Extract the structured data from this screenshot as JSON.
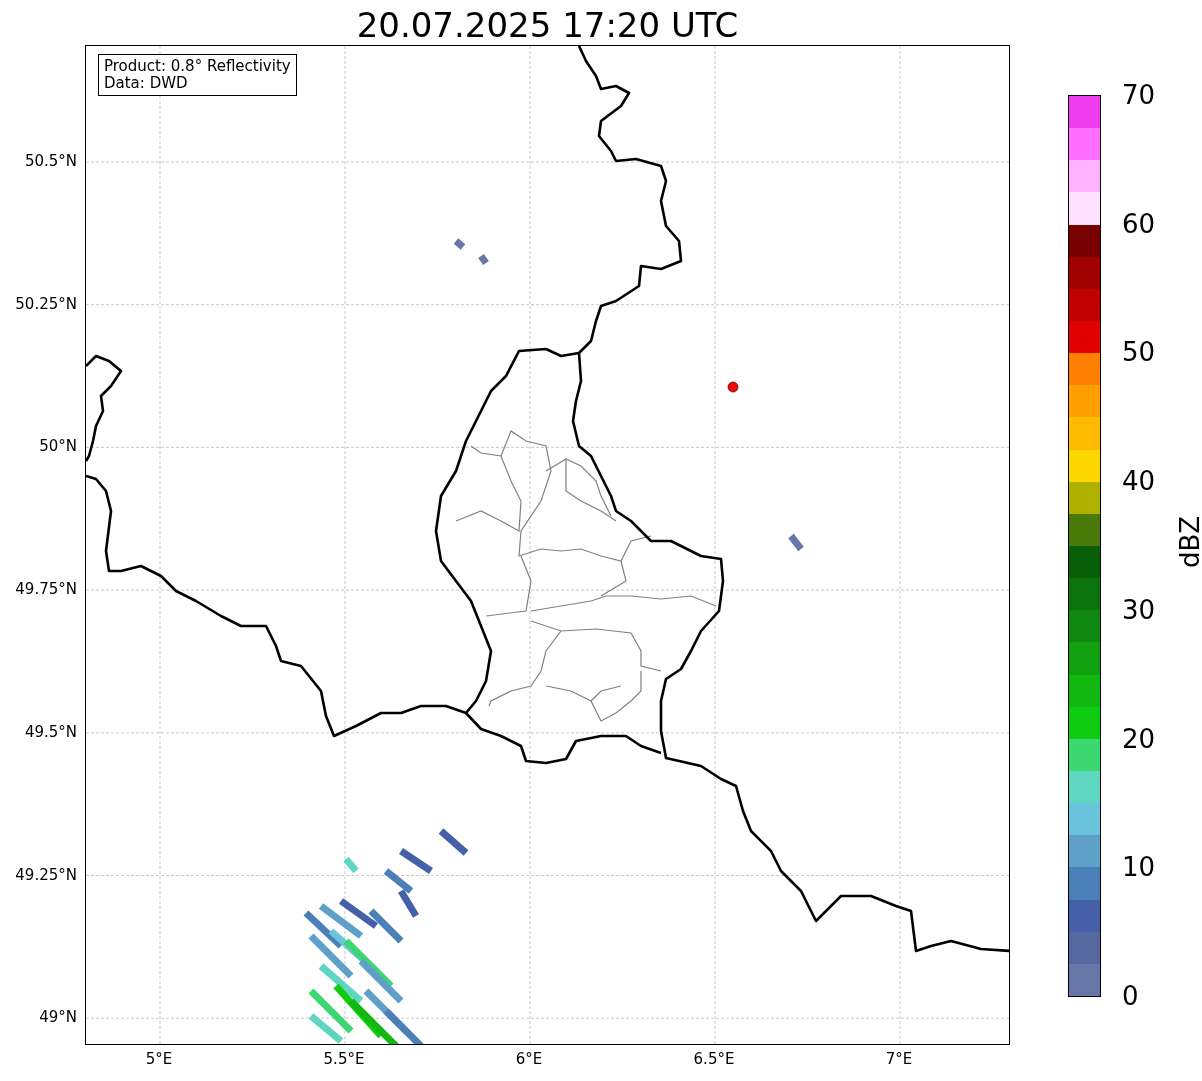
{
  "title": "20.07.2025 17:20 UTC",
  "info_box": {
    "lines": [
      "Product: 0.8° Reflectivity",
      "Data: DWD"
    ]
  },
  "map": {
    "lat_ticks": [
      "50.5°N",
      "50.25°N",
      "50°N",
      "49.75°N",
      "49.5°N",
      "49.25°N",
      "49°N"
    ],
    "lon_ticks": [
      "5°E",
      "5.5°E",
      "6°E",
      "6.5°E",
      "7°E"
    ]
  },
  "colorbar": {
    "label": "dBZ",
    "ticks": [
      "70",
      "60",
      "50",
      "40",
      "30",
      "20",
      "10",
      "0"
    ],
    "bins": [
      {
        "color": "#ee3cee"
      },
      {
        "color": "#ff6eff"
      },
      {
        "color": "#ffb3ff"
      },
      {
        "color": "#ffe0ff"
      },
      {
        "color": "#780000"
      },
      {
        "color": "#a00000"
      },
      {
        "color": "#c00000"
      },
      {
        "color": "#e00000"
      },
      {
        "color": "#ff7f00"
      },
      {
        "color": "#ff9f00"
      },
      {
        "color": "#ffbb00"
      },
      {
        "color": "#ffd700"
      },
      {
        "color": "#b0b000"
      },
      {
        "color": "#4a7a0a"
      },
      {
        "color": "#085f08"
      },
      {
        "color": "#0b730b"
      },
      {
        "color": "#0f880f"
      },
      {
        "color": "#10a010"
      },
      {
        "color": "#10b810"
      },
      {
        "color": "#10cc10"
      },
      {
        "color": "#3cd770"
      },
      {
        "color": "#5fd7c0"
      },
      {
        "color": "#69c4dc"
      },
      {
        "color": "#5ea0c8"
      },
      {
        "color": "#4b7fb8"
      },
      {
        "color": "#4560a8"
      },
      {
        "color": "#5568a0"
      },
      {
        "color": "#6677a8"
      }
    ]
  }
}
